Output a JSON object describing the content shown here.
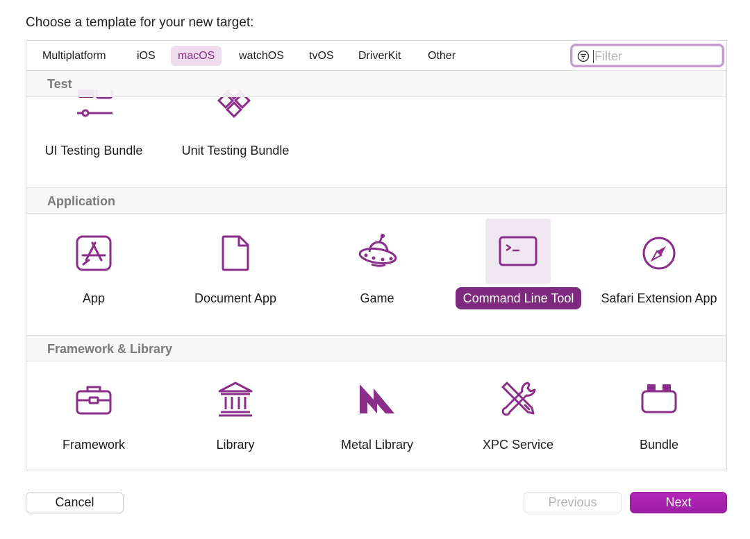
{
  "heading": "Choose a template for your new target:",
  "tabs": [
    {
      "label": "Multiplatform"
    },
    {
      "label": "iOS"
    },
    {
      "label": "macOS"
    },
    {
      "label": "watchOS"
    },
    {
      "label": "tvOS"
    },
    {
      "label": "DriverKit"
    },
    {
      "label": "Other"
    }
  ],
  "active_tab": "macOS",
  "filter": {
    "placeholder": "Filter",
    "value": ""
  },
  "sections": [
    {
      "title": "Test",
      "items": [
        {
          "label": "UI Testing Bundle",
          "icon": "ui-testing-icon"
        },
        {
          "label": "Unit Testing Bundle",
          "icon": "unit-testing-icon"
        }
      ]
    },
    {
      "title": "Application",
      "items": [
        {
          "label": "App",
          "icon": "app-store-icon"
        },
        {
          "label": "Document App",
          "icon": "document-icon"
        },
        {
          "label": "Game",
          "icon": "ufo-game-icon"
        },
        {
          "label": "Command Line Tool",
          "icon": "terminal-icon",
          "selected": true
        },
        {
          "label": "Safari Extension App",
          "icon": "compass-icon"
        }
      ]
    },
    {
      "title": "Framework & Library",
      "items": [
        {
          "label": "Framework",
          "icon": "toolbox-icon"
        },
        {
          "label": "Library",
          "icon": "library-icon"
        },
        {
          "label": "Metal Library",
          "icon": "metal-icon"
        },
        {
          "label": "XPC Service",
          "icon": "tools-icon"
        },
        {
          "label": "Bundle",
          "icon": "bundle-icon"
        }
      ]
    }
  ],
  "buttons": {
    "cancel": "Cancel",
    "previous": "Previous",
    "next": "Next"
  },
  "colors": {
    "accent": "#8b2d8a",
    "selection": "#7d2a7e",
    "next_button": "#a81fb0"
  }
}
